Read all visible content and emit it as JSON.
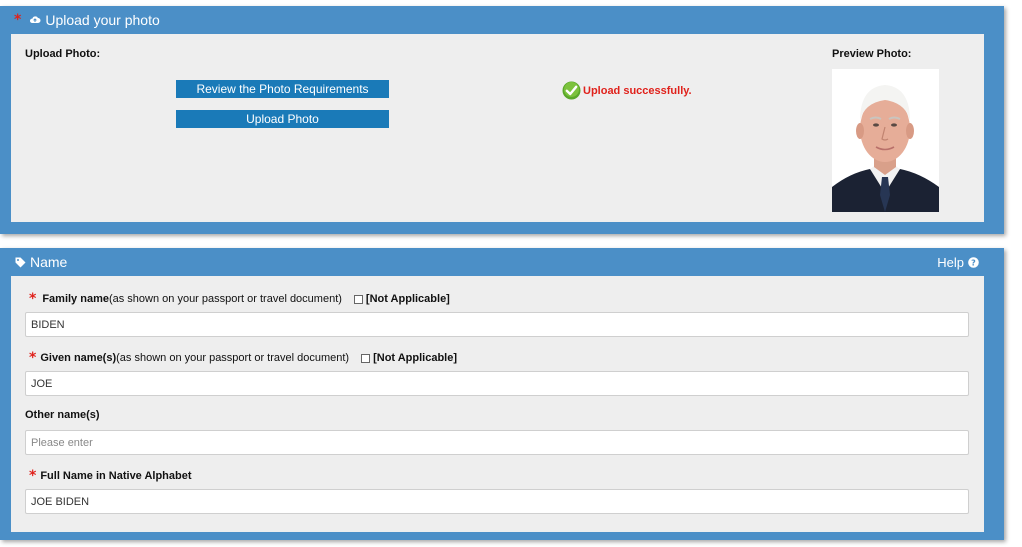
{
  "upload_section": {
    "title": "Upload your photo",
    "upload_label": "Upload Photo:",
    "preview_label": "Preview Photo:",
    "review_button": "Review the Photo Requirements",
    "upload_button": "Upload Photo",
    "status_text": "Upload successfully.",
    "required_marker": "*"
  },
  "name_section": {
    "title": "Name",
    "help": "Help",
    "family_name": {
      "required_marker": "*",
      "label": "Family name",
      "hint": "(as shown on your passport or travel document)",
      "not_applicable": "[Not Applicable]",
      "value": "BIDEN"
    },
    "given_name": {
      "required_marker": "*",
      "label": "Given name(s)",
      "hint": "(as shown on your passport or travel document)",
      "not_applicable": "[Not Applicable]",
      "value": "JOE"
    },
    "other_names": {
      "label": "Other name(s)",
      "placeholder": "Please enter",
      "value": ""
    },
    "native_name": {
      "required_marker": "*",
      "label": "Full Name in Native Alphabet",
      "value": "JOE BIDEN"
    }
  }
}
